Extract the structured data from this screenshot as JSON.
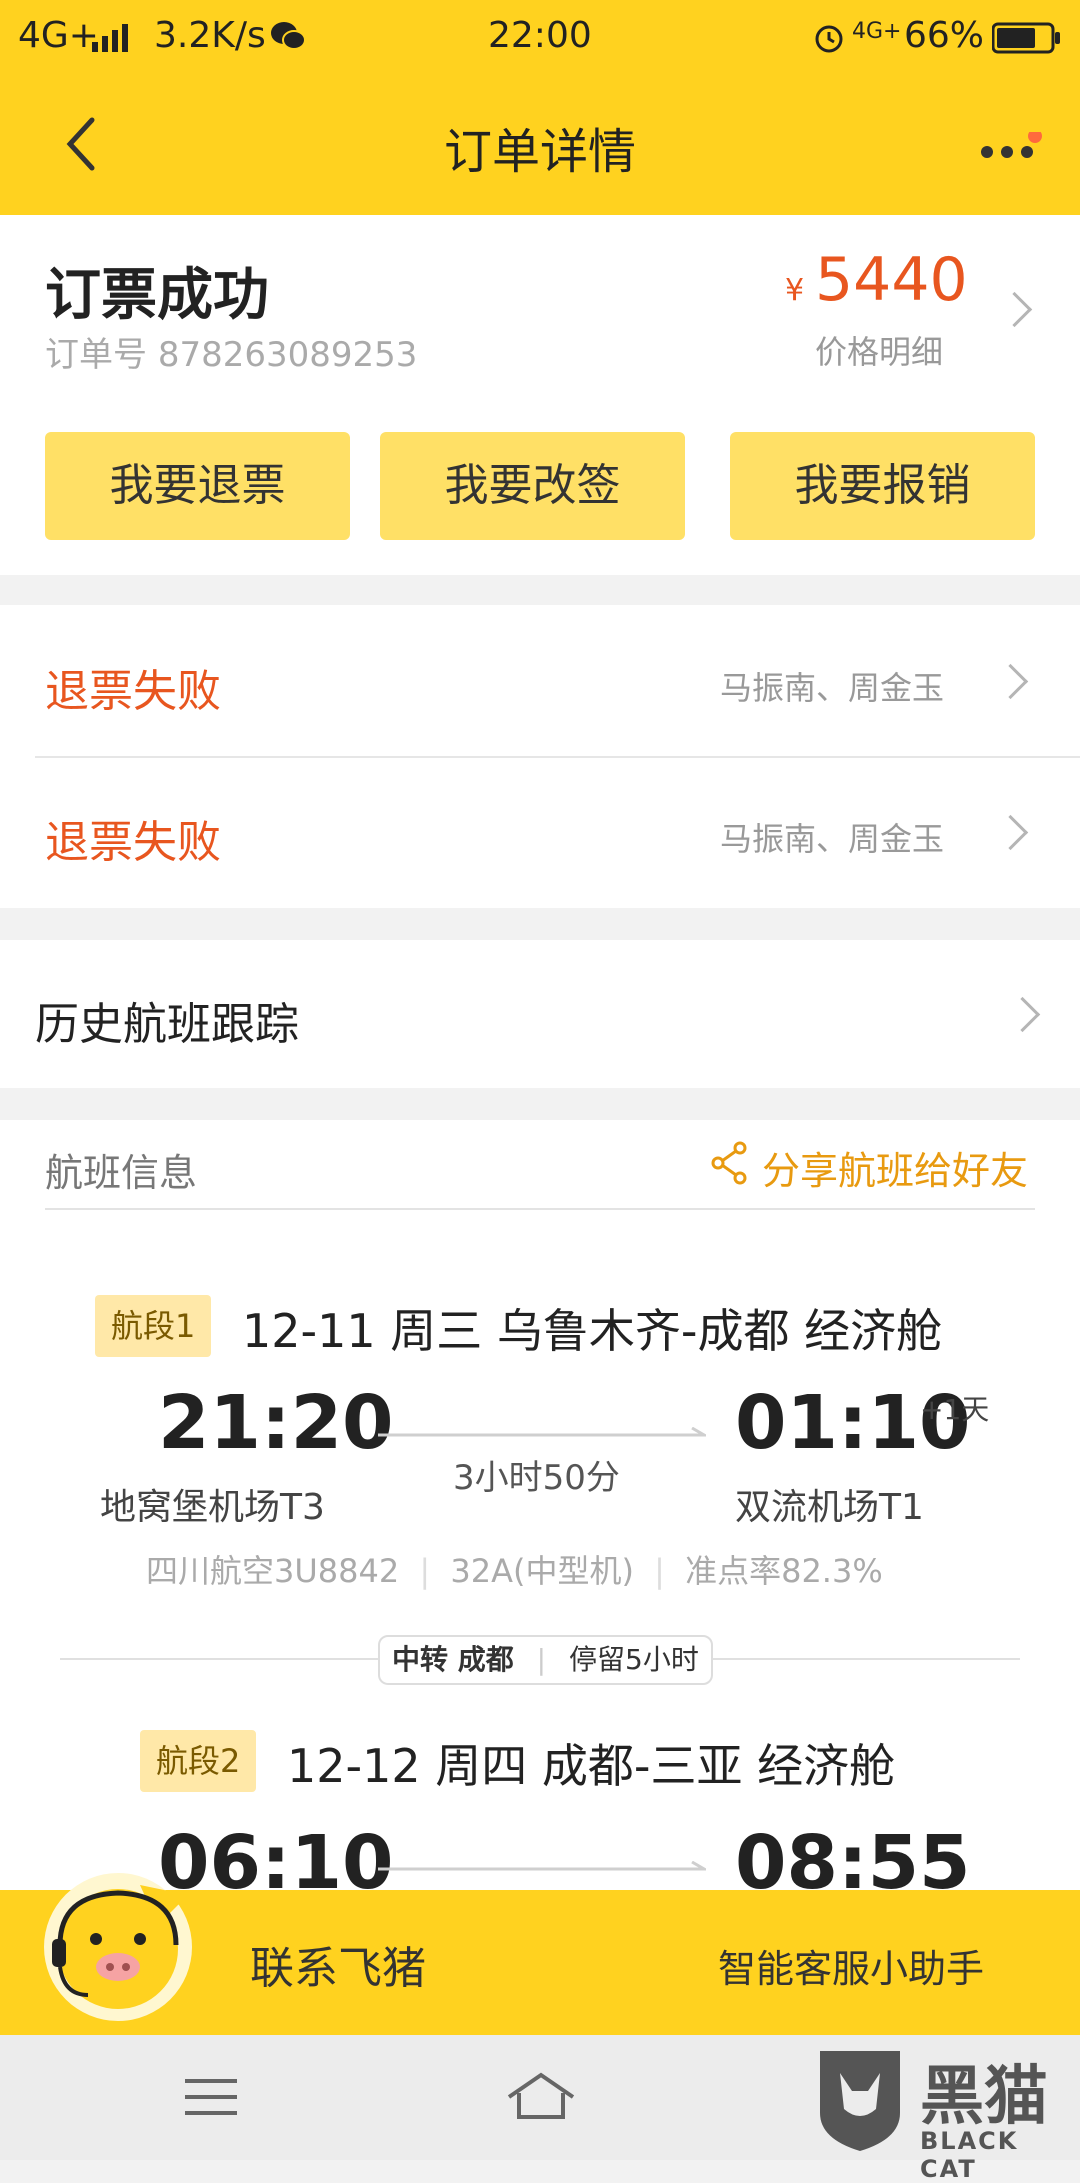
{
  "status_bar": {
    "network": "4G+",
    "speed": "3.2K/s",
    "time": "22:00",
    "network2": "4G+",
    "battery": "66%"
  },
  "header": {
    "title": "订单详情"
  },
  "order": {
    "status": "订票成功",
    "number_label": "订单号",
    "number": "878263089253",
    "currency": "¥",
    "price": "5440",
    "price_detail_label": "价格明细"
  },
  "actions": {
    "refund": "我要退票",
    "change": "我要改签",
    "reimburse": "我要报销"
  },
  "refund_rows": [
    {
      "status": "退票失败",
      "passengers": "马振南、周金玉"
    },
    {
      "status": "退票失败",
      "passengers": "马振南、周金玉"
    }
  ],
  "history": {
    "label": "历史航班跟踪"
  },
  "flight_info": {
    "section_label": "航班信息",
    "share_label": "分享航班给好友",
    "segments": [
      {
        "badge": "航段1",
        "title": "12-11  周三  乌鲁木齐-成都  经济舱",
        "dep_time": "21:20",
        "arr_time": "01:10",
        "next_day": "+1天",
        "duration": "3小时50分",
        "dep_airport": "地窝堡机场T3",
        "arr_airport": "双流机场T1",
        "airline": "四川航空3U8842",
        "aircraft": "32A(中型机)",
        "ontime": "准点率82.3%"
      },
      {
        "badge": "航段2",
        "title": "12-12  周四  成都-三亚  经济舱",
        "dep_time": "06:10",
        "arr_time": "08:55"
      }
    ],
    "transfer": {
      "label": "中转 成都",
      "stay": "停留5小时"
    }
  },
  "bottom": {
    "contact": "联系飞猪",
    "assistant": "智能客服小助手"
  },
  "watermark": {
    "cn": "黑猫",
    "en": "BLACK CAT"
  }
}
